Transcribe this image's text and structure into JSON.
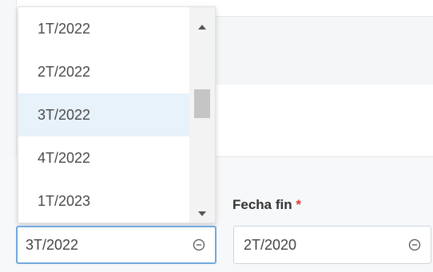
{
  "dropdown": {
    "options": [
      "1T/2022",
      "2T/2022",
      "3T/2022",
      "4T/2022",
      "1T/2023"
    ],
    "selected_index": 2
  },
  "end_date": {
    "label": "Fecha fin",
    "required_mark": "*",
    "value": "2T/2020"
  },
  "start_date": {
    "value": "3T/2022"
  },
  "colors": {
    "selected_option_bg": "#e8f2fb",
    "focus_border": "#6fa8dc",
    "required": "#e03a3a"
  },
  "icons": {
    "clear": "minus-circle-icon",
    "scroll_up": "scroll-up-arrow-icon",
    "scroll_down": "scroll-down-arrow-icon"
  }
}
